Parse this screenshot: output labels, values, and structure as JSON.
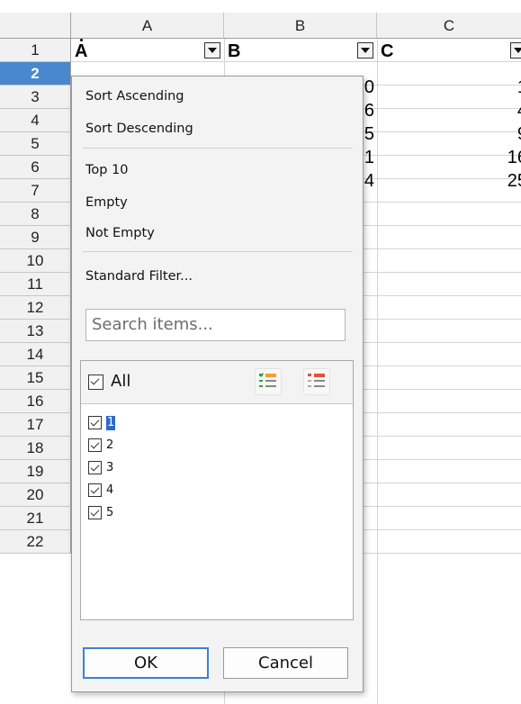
{
  "columns": [
    "A",
    "B",
    "C"
  ],
  "rows": [
    "1",
    "2",
    "3",
    "4",
    "5",
    "6",
    "7",
    "8",
    "9",
    "10",
    "11",
    "12",
    "13",
    "14",
    "15",
    "16",
    "17",
    "18",
    "19",
    "20",
    "21",
    "22"
  ],
  "active_row": "2",
  "cells": {
    "A1": "A",
    "B1": "B",
    "C1": "C",
    "B_values": [
      "0",
      "6",
      "5",
      "1",
      "4"
    ],
    "C_values": [
      "1",
      "4",
      "9",
      "16",
      "25"
    ]
  },
  "popup": {
    "sort_ascending": "Sort Ascending",
    "sort_descending": "Sort Descending",
    "top10": "Top 10",
    "empty": "Empty",
    "not_empty": "Not Empty",
    "standard_filter": "Standard Filter...",
    "search_placeholder": "Search items...",
    "all_label": "All",
    "items": [
      "1",
      "2",
      "3",
      "4",
      "5"
    ],
    "ok": "OK",
    "cancel": "Cancel"
  },
  "colors": {
    "active_row_header": "#4a88ce",
    "selection": "#2a6ccb",
    "default_button_border": "#3b82d6",
    "icon_orange": "#f0a030",
    "icon_green": "#35a235",
    "icon_red": "#e0533d"
  },
  "icons": [
    "dropdown-arrow-icon",
    "select-all-icon",
    "deselect-all-icon",
    "checkbox-checked-icon"
  ]
}
